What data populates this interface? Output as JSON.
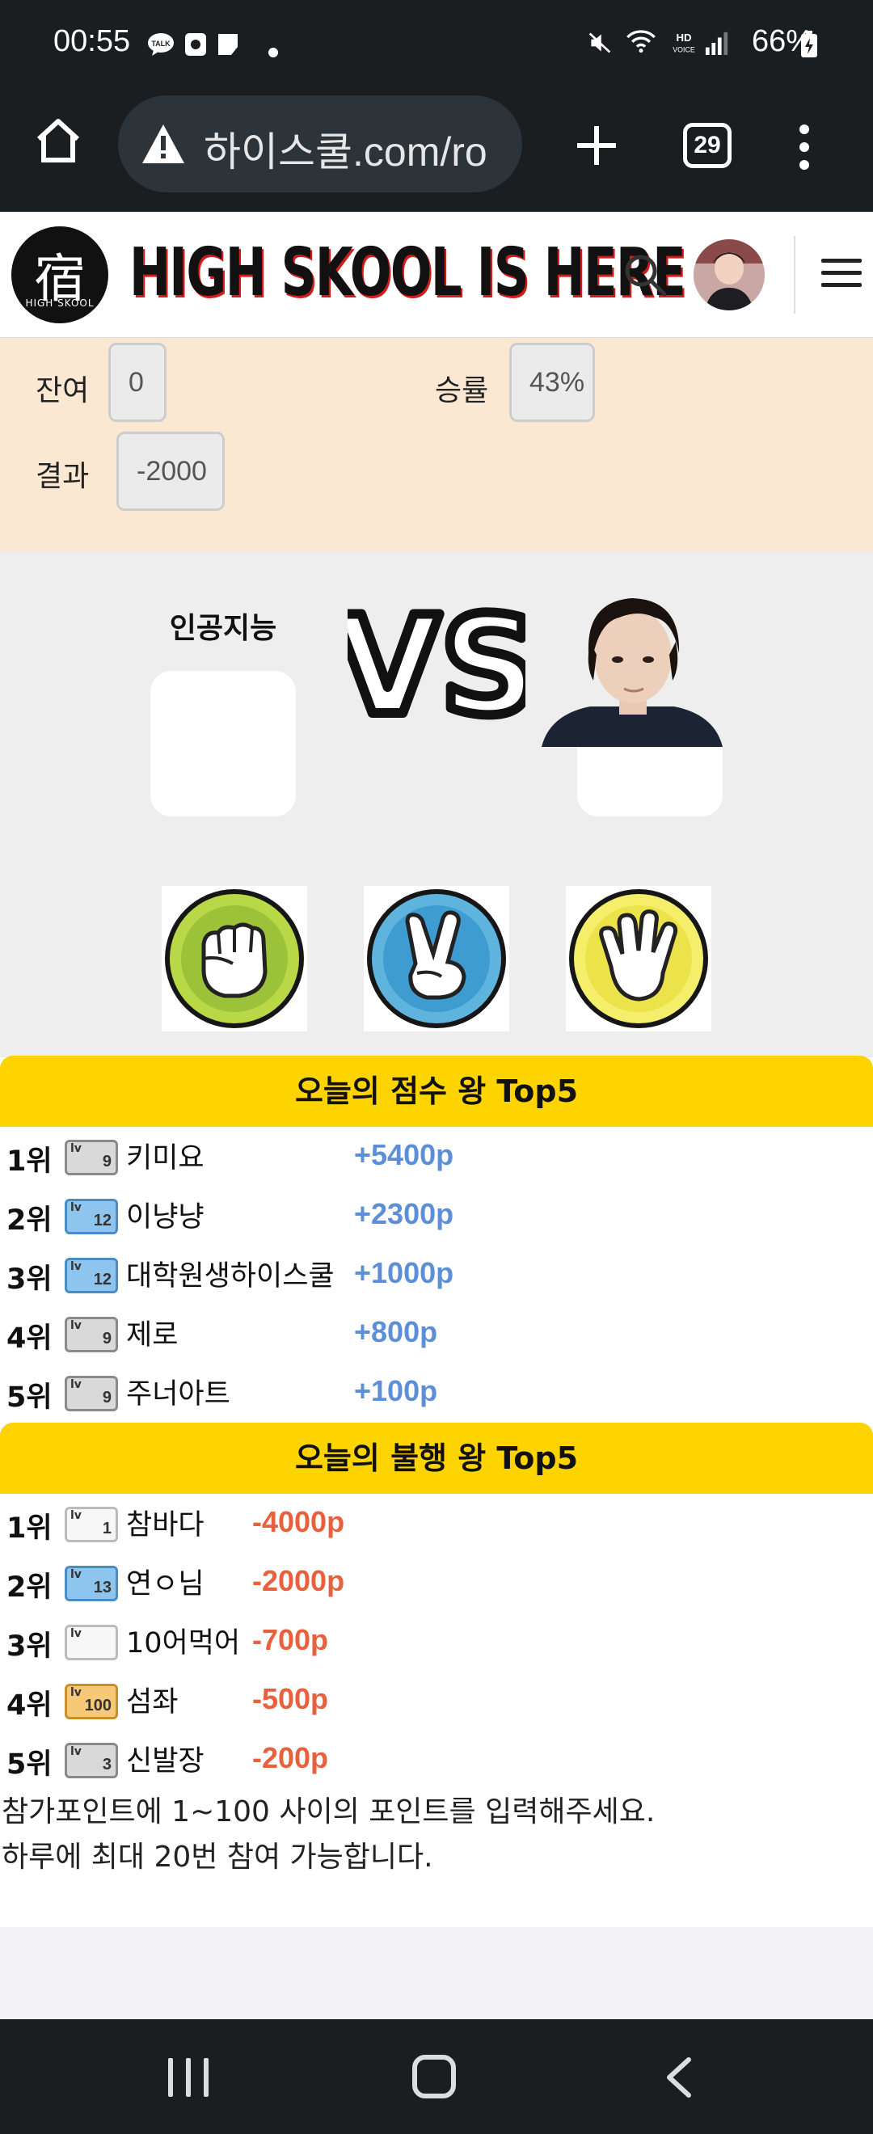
{
  "status_bar": {
    "time": "00:55",
    "battery": "66%",
    "net_label": "HD VOICE"
  },
  "browser": {
    "url": "하이스쿨.com/ro",
    "tab_count": "29"
  },
  "site": {
    "logo_char": "宿",
    "logo_sub": "HIGH SKOOL",
    "brand": "HIGH SKOOL IS HERE"
  },
  "stats": {
    "remaining_label": "잔여",
    "remaining_value": "0",
    "winrate_label": "승률",
    "winrate_value": "43%",
    "result_label": "결과",
    "result_value": "-2000"
  },
  "game": {
    "ai_name": "인공지능",
    "vs_text": "VS",
    "choices": [
      "rock",
      "scissors",
      "paper"
    ]
  },
  "score_kings": {
    "title": "오늘의 점수 왕 Top5",
    "rows": [
      {
        "rank": "1위",
        "level": "9",
        "badge": "gray",
        "name": "키미요",
        "points": "+5400p"
      },
      {
        "rank": "2위",
        "level": "12",
        "badge": "blue",
        "name": "이냥냥",
        "points": "+2300p"
      },
      {
        "rank": "3위",
        "level": "12",
        "badge": "blue",
        "name": "대학원생하이스쿨",
        "points": "+1000p"
      },
      {
        "rank": "4위",
        "level": "9",
        "badge": "gray",
        "name": "제로",
        "points": "+800p"
      },
      {
        "rank": "5위",
        "level": "9",
        "badge": "gray",
        "name": "주너아트",
        "points": "+100p"
      }
    ]
  },
  "unlucky_kings": {
    "title": "오늘의 불행 왕 Top5",
    "rows": [
      {
        "rank": "1위",
        "level": "1",
        "badge": "white",
        "name": "참바다",
        "points": "-4000p"
      },
      {
        "rank": "2위",
        "level": "13",
        "badge": "blue",
        "name": "연ㅇ님",
        "points": "-2000p"
      },
      {
        "rank": "3위",
        "level": "",
        "badge": "white",
        "name": "10어먹어",
        "points": "-700p"
      },
      {
        "rank": "4위",
        "level": "100",
        "badge": "gold",
        "name": "섬좌",
        "points": "-500p"
      },
      {
        "rank": "5위",
        "level": "3",
        "badge": "gray",
        "name": "신발장",
        "points": "-200p"
      }
    ]
  },
  "notice": {
    "line1": "참가포인트에 1~100 사이의 포인트를 입력해주세요.",
    "line2": "하루에 최대 20번 참여 가능합니다."
  },
  "colors": {
    "accent": "#fdd300",
    "positive": "#5d8fd8",
    "negative": "#e8603c",
    "panel": "#fbe8d3"
  }
}
